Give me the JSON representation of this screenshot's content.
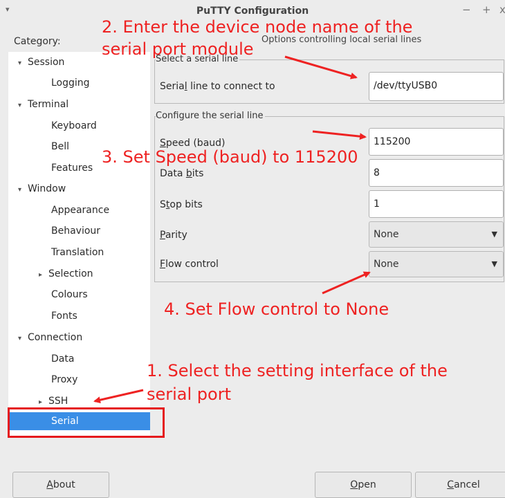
{
  "window": {
    "title": "PuTTY Configuration",
    "menu_glyph": "▾",
    "minimize_glyph": "−",
    "maximize_glyph": "+",
    "close_glyph": "x"
  },
  "category_label": "Category:",
  "tree": {
    "session": "Session",
    "logging": "Logging",
    "terminal": "Terminal",
    "keyboard": "Keyboard",
    "bell": "Bell",
    "features": "Features",
    "window": "Window",
    "appearance": "Appearance",
    "behaviour": "Behaviour",
    "translation": "Translation",
    "selection": "Selection",
    "colours": "Colours",
    "fonts": "Fonts",
    "connection": "Connection",
    "data": "Data",
    "proxy": "Proxy",
    "ssh": "SSH",
    "serial": "Serial",
    "expanded_arrow": "▾",
    "collapsed_arrow": "▸"
  },
  "panel_title": "Options controlling local serial lines",
  "group_select": {
    "title": "Select a serial line",
    "line_label_pre": "Seria",
    "line_label_ul": "l",
    "line_label_post": " line to connect to",
    "line_value": "/dev/ttyUSB0"
  },
  "group_config": {
    "title": "Configure the serial line",
    "speed_label_pre": "",
    "speed_label_ul": "S",
    "speed_label_post": "peed (baud)",
    "speed_value": "115200",
    "data_label_pre": "Data ",
    "data_label_ul": "b",
    "data_label_post": "its",
    "data_value": "8",
    "stop_label_pre": "S",
    "stop_label_ul": "t",
    "stop_label_post": "op bits",
    "stop_value": "1",
    "parity_label_pre": "",
    "parity_label_ul": "P",
    "parity_label_post": "arity",
    "parity_value": "None",
    "flow_label_pre": "",
    "flow_label_ul": "F",
    "flow_label_post": "low control",
    "flow_value": "None",
    "caret": "▼"
  },
  "buttons": {
    "about_ul": "A",
    "about_rest": "bout",
    "open_ul": "O",
    "open_rest": "pen",
    "cancel_ul": "C",
    "cancel_rest": "ancel"
  },
  "annotations": {
    "step2_line1": "2. Enter the device node name of the",
    "step2_line2": "serial port module",
    "step3": "3. Set Speed (baud) to 115200",
    "step4": "4. Set Flow control to None",
    "step1_line1": "1. Select the setting interface of the",
    "step1_line2": "serial port",
    "color": "#ee2222"
  }
}
